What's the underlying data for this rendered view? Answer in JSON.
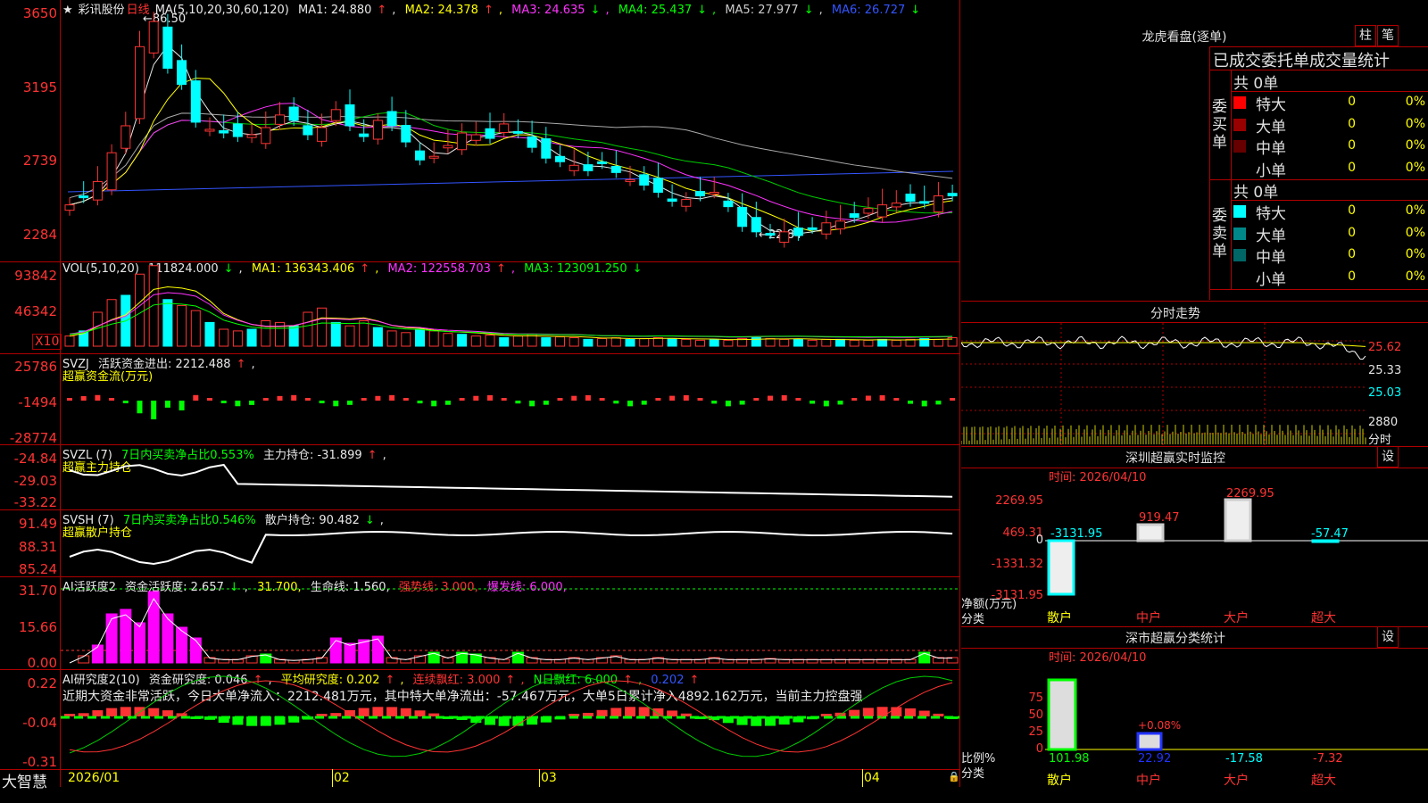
{
  "stock": {
    "star": "★",
    "name": "彩讯股份",
    "period": "日线",
    "high_mark": "86.50",
    "low_mark": "22.84"
  },
  "main_legend": {
    "ma_params": "MA(5,10,20,30,60,120)",
    "items": [
      {
        "label": "MA1: 24.880",
        "arrow": "↑",
        "color": "#e8e8e8"
      },
      {
        "label": "MA2: 24.378",
        "arrow": "↑",
        "color": "#ffff00"
      },
      {
        "label": "MA3: 24.635",
        "arrow": "↓",
        "color": "#ff33ff"
      },
      {
        "label": "MA4: 25.437",
        "arrow": "↓",
        "color": "#00ff00"
      },
      {
        "label": "MA5: 27.977",
        "arrow": "↓",
        "color": "#aaaaaa"
      },
      {
        "label": "MA6: 26.727",
        "arrow": "↓",
        "color": "#3355ff"
      }
    ]
  },
  "price_axis": [
    "3650",
    "3195",
    "2739",
    "2284"
  ],
  "vol_legend": {
    "name": "VOL(5,10,20)",
    "value": "111824.000",
    "value_arrow": "↓",
    "items": [
      {
        "label": "MA1: 136343.406",
        "arrow": "↑",
        "color": "#ffff00"
      },
      {
        "label": "MA2: 122558.703",
        "arrow": "↑",
        "color": "#ff33ff"
      },
      {
        "label": "MA3: 123091.250",
        "arrow": "↓",
        "color": "#00ff00"
      }
    ]
  },
  "vol_axis": [
    "93842",
    "46342"
  ],
  "vol_unit": "X10",
  "svzj": {
    "name": "SVZJ",
    "label": "活跃资金进出: 2212.488",
    "arrow": "↑",
    "sub": "超赢资金流(万元)",
    "axis": [
      "25786",
      "-1494",
      "-28774"
    ]
  },
  "svzl": {
    "name": "SVZL (7)",
    "ratio": "7日内买卖净占比0.553%",
    "label": "主力持仓: -31.899",
    "arrow": "↑",
    "sub": "超赢主力持仓",
    "axis": [
      "-24.84",
      "-29.03",
      "-33.22"
    ]
  },
  "svsh": {
    "name": "SVSH (7)",
    "ratio": "7日内买卖净占比0.546%",
    "label": "散户持仓: 90.482",
    "arrow": "↓",
    "sub": "超赢散户持仓",
    "axis": [
      "91.49",
      "88.31",
      "85.24"
    ]
  },
  "ai_active": {
    "name": "AI活跃度2",
    "label": "资金活跃度: 2.657",
    "arrow": "↓",
    "v2": "31.700,",
    "life": "生命线: 1.560,",
    "strong": "强势线: 3.000,",
    "burst": "爆发线: 6.000,",
    "axis": [
      "31.70",
      "15.66",
      "0.00"
    ]
  },
  "ai_research": {
    "name": "AI研究度2(10)",
    "label": "资金研究度: 0.046",
    "arrow": "↑",
    "avg": "平均研究度: 0.202",
    "avg_arrow": "↑",
    "red": "连续飘红: 3.000",
    "red_arrow": "↑",
    "nred": "N日飘红: 6.000",
    "nred_arrow": "↑",
    "last": "0.202",
    "last_arrow": "↑",
    "comment": "近期大资金非常活跃，今日大单净流入：2212.481万元，其中特大单净流出：-57.467万元，大单5日累计净入4892.162万元，当前主力控盘强",
    "axis": [
      "0.22",
      "-0.04",
      "-0.31"
    ]
  },
  "x_axis": {
    "brand": "大智慧",
    "labels": [
      "2026/01",
      "02",
      "03",
      "04"
    ]
  },
  "dragon": {
    "title": "龙虎看盘(逐单)",
    "btn1": "柱",
    "btn2": "笔",
    "header": "已成交委托单成交量统计",
    "buy_total": "共 0单",
    "buy_side": "委买单",
    "sell_total": "共 0单",
    "sell_side": "委卖单",
    "buy_rows": [
      {
        "label": "特大",
        "color": "#ff0000",
        "count": "0",
        "pct": "0%"
      },
      {
        "label": "大单",
        "color": "#990000",
        "count": "0",
        "pct": "0%"
      },
      {
        "label": "中单",
        "color": "#660000",
        "count": "0",
        "pct": "0%"
      },
      {
        "label": "小单",
        "color": "#000000",
        "count": "0",
        "pct": "0%"
      }
    ],
    "sell_rows": [
      {
        "label": "特大",
        "color": "#00ffff",
        "count": "0",
        "pct": "0%"
      },
      {
        "label": "大单",
        "color": "#008888",
        "count": "0",
        "pct": "0%"
      },
      {
        "label": "中单",
        "color": "#006666",
        "count": "0",
        "pct": "0%"
      },
      {
        "label": "小单",
        "color": "#000000",
        "count": "0",
        "pct": "0%"
      }
    ]
  },
  "intraday": {
    "title": "分时走势",
    "axis": [
      "25.62",
      "25.33",
      "25.03"
    ],
    "vol_top": "2880",
    "vol_label": "分时"
  },
  "sz_monitor": {
    "title": "深圳超赢实时监控",
    "btn": "设",
    "time": "时间: 2026/04/10",
    "axis": [
      "2269.95",
      "469.31",
      "0",
      "-1331.32",
      "-3131.95"
    ],
    "unit1": "净额(万元)",
    "unit2": "分类",
    "cats": [
      "散户",
      "中户",
      "大户",
      "超大"
    ],
    "values": [
      "-3131.95",
      "919.47",
      "2269.95",
      "-57.47"
    ]
  },
  "sz_class": {
    "title": "深市超赢分类统计",
    "btn": "设",
    "time": "时间: 2026/04/10",
    "axis": [
      "75",
      "50",
      "25",
      "0"
    ],
    "unit1": "比例%",
    "unit2": "分类",
    "cats": [
      "散户",
      "中户",
      "大户",
      "超大"
    ],
    "values": [
      "101.98",
      "22.92",
      "-17.58",
      "-7.32"
    ],
    "mid_note": "+0.08%"
  }
}
